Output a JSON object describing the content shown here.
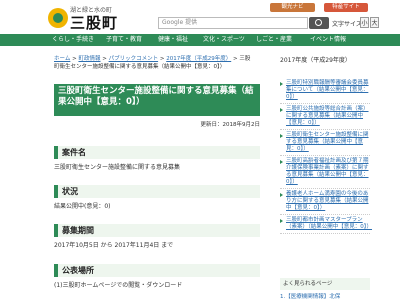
{
  "header": {
    "logo_sub": "湖と緑と水の町",
    "logo_main": "三股町",
    "btn_a": "観光ナビ",
    "btn_b": "特産サイト",
    "search_placeholder": "Google 提供",
    "fontsize_label": "文字サイズ",
    "fs_small": "小",
    "fs_large": "大"
  },
  "nav": [
    "くらし・手続き",
    "子育て・教育",
    "健康・福祉",
    "文化・スポーツ",
    "しごと・産業",
    "イベント情報"
  ],
  "breadcrumb": {
    "home": "ホーム",
    "l1": "町政情報",
    "l2": "パブリックコメント",
    "l3": "2017年度（平成29年度）",
    "current": "三股町衛生センター施設整備に関する意見募集（結果公開中【意見：0】）"
  },
  "page": {
    "title": "三股町衛生センター施設整備に関する意見募集（結果公開中【意見：0】）",
    "updated": "更新日：2018年9月2日"
  },
  "sections": [
    {
      "head": "案件名",
      "body": "三股町衛生センター施設整備に関する意見募集"
    },
    {
      "head": "状況",
      "body": "結果公開中(意見：0)"
    },
    {
      "head": "募集期間",
      "body": "2017年10月5日 から 2017年11月4日 まで"
    },
    {
      "head": "公表場所",
      "body": "(1)三股町ホームページでの閲覧・ダウンロード"
    }
  ],
  "sidebar": {
    "head": "2017年度（平成29年度）",
    "items": [
      "三股町特別職報酬等審議会委員募集について（結果公開中【意見：0】）",
      "三股町公共施設等総合計画（案）に関する意見募集（結果公開中【意見：0】）",
      "三股町衛生センター施設整備に関する意見募集（結果公開中【意見：0】）",
      "三股町高齢者福祉計画及び第７期介護保険事業計画（素案）に関する意見募集（結果公開中【意見：0】）",
      "養護老人ホーム満寿園の今後のあり方に関する意見募集（結果公開中【意見：0】）",
      "三股町都市計画マスタープラン（素案）（結果公開中【意見：0】）"
    ],
    "foot_head": "よく見られるページ",
    "foot_item": "1.【医療機関情報】北保"
  }
}
